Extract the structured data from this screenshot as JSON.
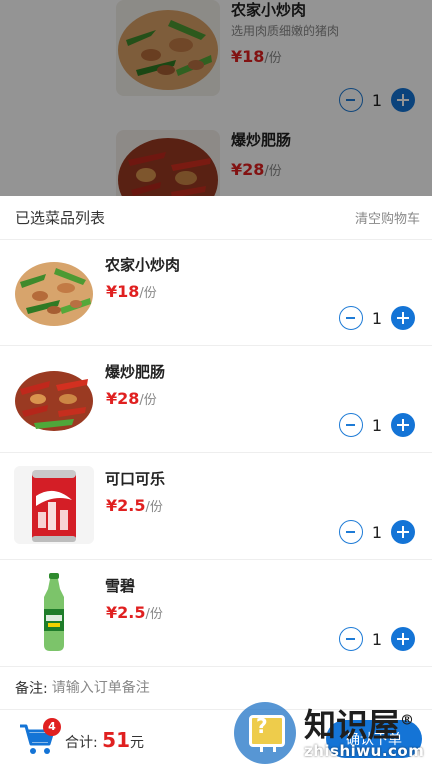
{
  "colors": {
    "accent": "#1474d6",
    "price": "#e02020",
    "overlay": "rgba(0,0,0,0.42)"
  },
  "menu_background": {
    "items": [
      {
        "name": "农家小炒肉",
        "desc": "选用肉质细嫩的猪肉",
        "price_symbol": "¥",
        "price": "18",
        "unit": "/份",
        "qty": "1",
        "image": "stir-fried-pork-image"
      },
      {
        "name": "爆炒肥肠",
        "price_symbol": "¥",
        "price": "28",
        "unit": "/份",
        "image": "spicy-intestines-image"
      }
    ]
  },
  "cart": {
    "title": "已选菜品列表",
    "clear_label": "清空购物车",
    "items": [
      {
        "name": "农家小炒肉",
        "price_symbol": "¥",
        "price": "18",
        "unit": "/份",
        "qty": "1",
        "image": "stir-fried-pork-image"
      },
      {
        "name": "爆炒肥肠",
        "price_symbol": "¥",
        "price": "28",
        "unit": "/份",
        "qty": "1",
        "image": "spicy-intestines-image"
      },
      {
        "name": "可口可乐",
        "price_symbol": "¥",
        "price": "2.5",
        "unit": "/份",
        "qty": "1",
        "image": "coca-cola-can-image"
      },
      {
        "name": "雪碧",
        "price_symbol": "¥",
        "price": "2.5",
        "unit": "/份",
        "qty": "1",
        "image": "sprite-bottle-image"
      }
    ]
  },
  "remark": {
    "label": "备注:",
    "placeholder": "请输入订单备注"
  },
  "footer": {
    "cart_icon": "shopping-cart-icon",
    "badge_count": "4",
    "total_label": "合计:",
    "total_amount": "51",
    "total_unit": "元",
    "confirm_label": "确认下单"
  },
  "watermark": {
    "title": "知识屋",
    "registered": "®",
    "subtitle": "zhishiwu.com",
    "icon": "help-monitor-icon"
  }
}
